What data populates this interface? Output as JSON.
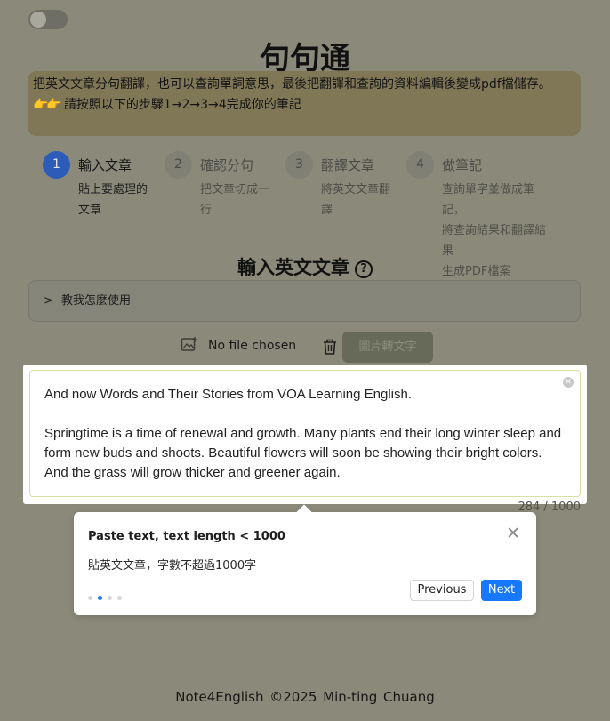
{
  "app": {
    "title": "句句通",
    "intro_line1": "把英文文章分句翻譯，也可以查詢單詞意思，最後把翻譯和查詢的資料編輯後變成pdf檔儲存。",
    "intro_line2": "請按照以下的步驟1→2→3→4完成你的筆記"
  },
  "steps": [
    {
      "num": "1",
      "title": "輸入文章",
      "desc": [
        "貼上要處理的",
        "文章"
      ],
      "active": true
    },
    {
      "num": "2",
      "title": "確認分句",
      "desc": [
        "把文章切成一",
        "行"
      ],
      "active": false
    },
    {
      "num": "3",
      "title": "翻譯文章",
      "desc": [
        "將英文文章翻",
        "譯"
      ],
      "active": false
    },
    {
      "num": "4",
      "title": "做筆記",
      "desc": [
        "查詢單字並做成筆記，",
        "將查詢結果和翻譯結果",
        "生成PDF檔案"
      ],
      "active": false
    }
  ],
  "input": {
    "section_title": "輸入英文文章",
    "help_glyph": "?",
    "howto_label": "教我怎麼使用",
    "file_status": "No file chosen",
    "ocr_button": "圖片轉文字",
    "text_p1": "And now Words and Their Stories from VOA Learning English.",
    "text_p2": "Springtime is a time of renewal and growth. Many plants end their long winter sleep and form new buds and shoots. Beautiful flowers will soon be showing their bright colors. And the grass will grow thicker and greener again.",
    "counter": "284 / 1000"
  },
  "tour": {
    "title": "Paste text, text length < 1000",
    "description": "貼英文文章，字數不超過1000字",
    "total_steps": 4,
    "current_step": 2,
    "prev_label": "Previous",
    "next_label": "Next"
  },
  "footer": {
    "text": "Note4English  ©2025  Min-ting Chuang"
  },
  "icons": {
    "toggle": "toggle-icon",
    "help": "question-circle-icon",
    "chevron": "chevron-right-icon",
    "image_upload": "image-add-icon",
    "trash": "trash-icon",
    "close": "close-icon",
    "clear": "clear-circle-icon"
  },
  "colors": {
    "accent": "#1677ff",
    "step_active": "#2d5cb8",
    "overlay": "#8b8a7a"
  }
}
